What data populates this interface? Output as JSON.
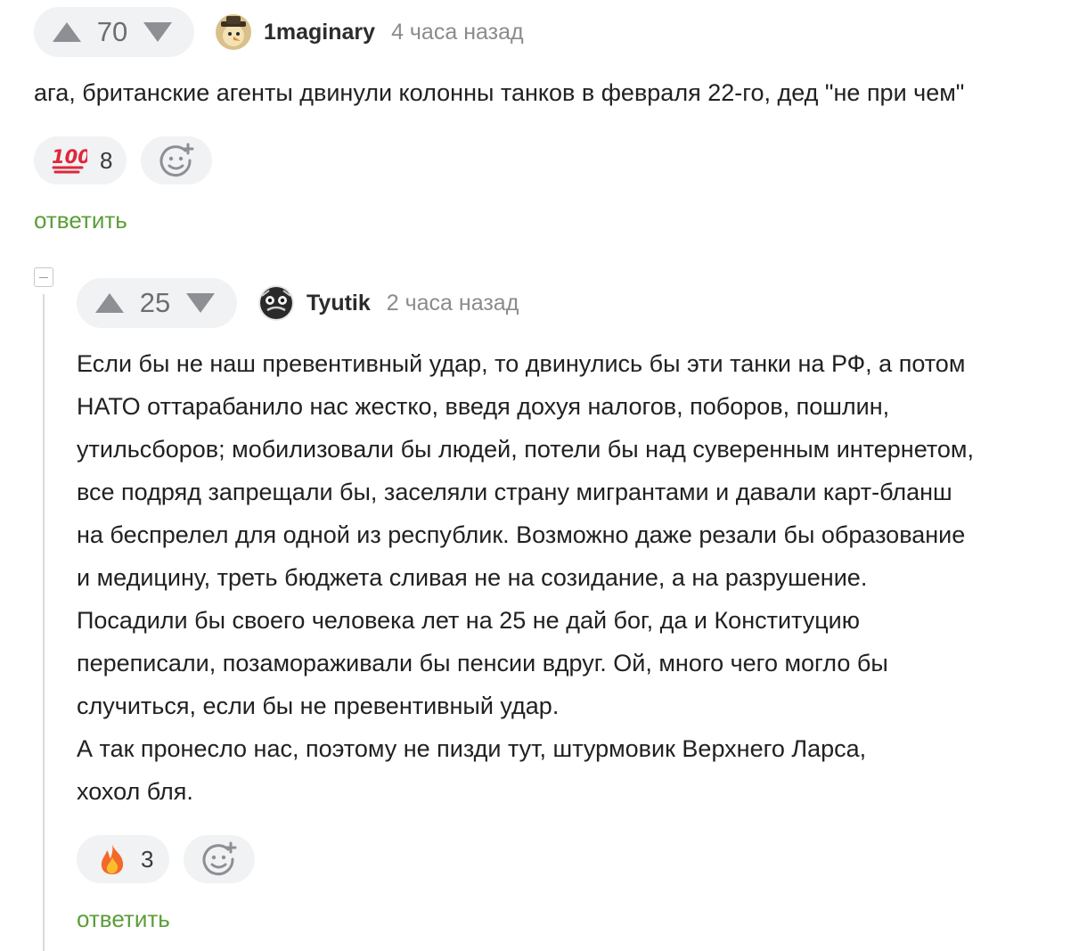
{
  "comments": [
    {
      "votes": "70",
      "author": "1maginary",
      "time": "4 часа назад",
      "text": "ага, британские агенты двинули колонны танков в февраля 22-го, дед \"не при чем\"",
      "reaction": {
        "emoji": "hundred-points-icon",
        "count": "8"
      },
      "reply_label": "ответить"
    },
    {
      "votes": "25",
      "author": "Tyutik",
      "time": "2 часа назад",
      "text": "Если бы не наш превентивный удар, то двинулись бы эти танки на РФ, а потом\nНАТО оттарабанило нас жестко, введя дохуя налогов, поборов, пошлин,\nутильсборов; мобилизовали бы людей, потели бы над суверенным интернетом,\nвсе подряд запрещали бы, заселяли страну мигрантами и давали карт-бланш\nна беспрелел для одной из республик. Возможно даже резали бы образование\nи медицину, треть бюджета сливая не на созидание, а на разрушение.\nПосадили бы своего человека лет на 25 не дай бог, да и Конституцию\nпереписали, позамораживали бы пенсии вдруг. Ой, много чего могло бы\nслучиться, если бы не превентивный удар.\nА так пронесло нас, поэтому не пизди тут, штурмовик Верхнего Ларса,\nхохол бля.",
      "reaction": {
        "emoji": "fire-icon",
        "count": "3"
      },
      "reply_label": "ответить"
    }
  ],
  "colors": {
    "pill_bg": "#f1f2f4",
    "reply_green": "#5a9e38",
    "muted": "#8b8b8f"
  }
}
